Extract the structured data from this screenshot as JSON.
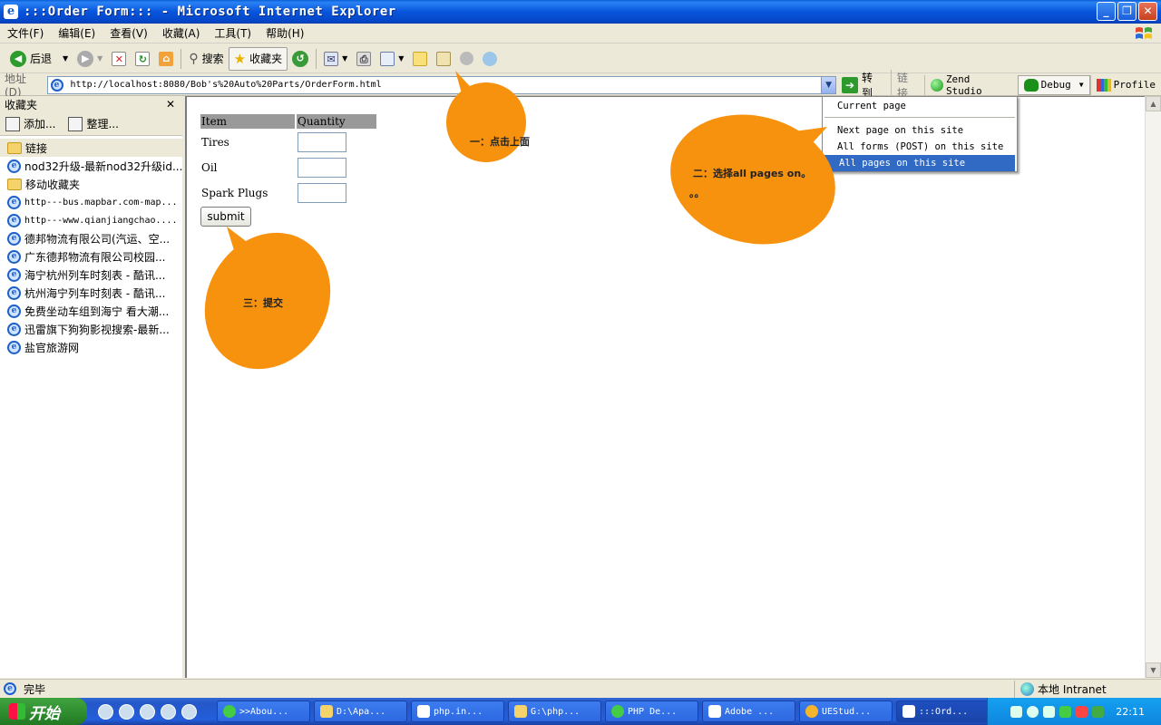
{
  "window": {
    "title": ":::Order Form::: - Microsoft Internet Explorer",
    "icon_letter": "e",
    "controls": [
      "_",
      "❐",
      "✕"
    ]
  },
  "menubar": {
    "items": [
      "文件(F)",
      "编辑(E)",
      "查看(V)",
      "收藏(A)",
      "工具(T)",
      "帮助(H)"
    ]
  },
  "toolbar": {
    "back_label": "后退",
    "search_label": "搜索",
    "favorites_label": "收藏夹"
  },
  "addressbar": {
    "label": "地址(D)",
    "url": "http://localhost:8080/Bob's%20Auto%20Parts/OrderForm.html",
    "go_label": "转到",
    "links_label": "链接",
    "zend_label": "Zend Studio",
    "debug_label": "Debug",
    "profile_label": "Profile"
  },
  "favorites": {
    "header": "收藏夹",
    "close": "✕",
    "add_label": "添加...",
    "organize_label": "整理...",
    "items": [
      {
        "label": "链接",
        "type": "folder"
      },
      {
        "label": "nod32升级-最新nod32升级id...",
        "type": "page"
      },
      {
        "label": "移动收藏夹",
        "type": "folder"
      },
      {
        "label": "http---bus.mapbar.com-map...",
        "type": "page"
      },
      {
        "label": "http---www.qianjiangchao....",
        "type": "page"
      },
      {
        "label": "德邦物流有限公司(汽运、空...",
        "type": "page"
      },
      {
        "label": "广东德邦物流有限公司校园...",
        "type": "page"
      },
      {
        "label": "海宁杭州列车时刻表 - 酷讯...",
        "type": "page"
      },
      {
        "label": "杭州海宁列车时刻表 - 酷讯...",
        "type": "page"
      },
      {
        "label": "免费坐动车组到海宁 看大潮...",
        "type": "page"
      },
      {
        "label": "迅雷旗下狗狗影视搜索-最新...",
        "type": "page"
      },
      {
        "label": "盐官旅游网",
        "type": "page"
      }
    ]
  },
  "form": {
    "headers": [
      "Item",
      "Quantity"
    ],
    "rows": [
      "Tires",
      "Oil",
      "Spark Plugs"
    ],
    "submit_label": "submit"
  },
  "debug_menu": {
    "items": [
      {
        "label": "Current page"
      },
      {
        "label": "Next page on this site"
      },
      {
        "label": "All forms (POST) on this site"
      },
      {
        "label": "All pages on this site",
        "active": true
      }
    ]
  },
  "annotations": {
    "step1": "一：点击上面",
    "step2_line1": "二：选择all pages on。",
    "step2_line2": "。。",
    "step3": "三：提交"
  },
  "statusbar": {
    "left": "完毕",
    "zone": "本地 Intranet"
  },
  "taskbar": {
    "start_label": "开始",
    "tasks": [
      ">>Abou...",
      "D:\\Apa...",
      "php.in...",
      "G:\\php...",
      "PHP De...",
      "Adobe ...",
      "UEStud...",
      ":::Ord..."
    ],
    "clock": "22:11"
  },
  "colors": {
    "bubble": "#f7920f",
    "menu_highlight": "#316ac5",
    "table_header": "#999999"
  }
}
